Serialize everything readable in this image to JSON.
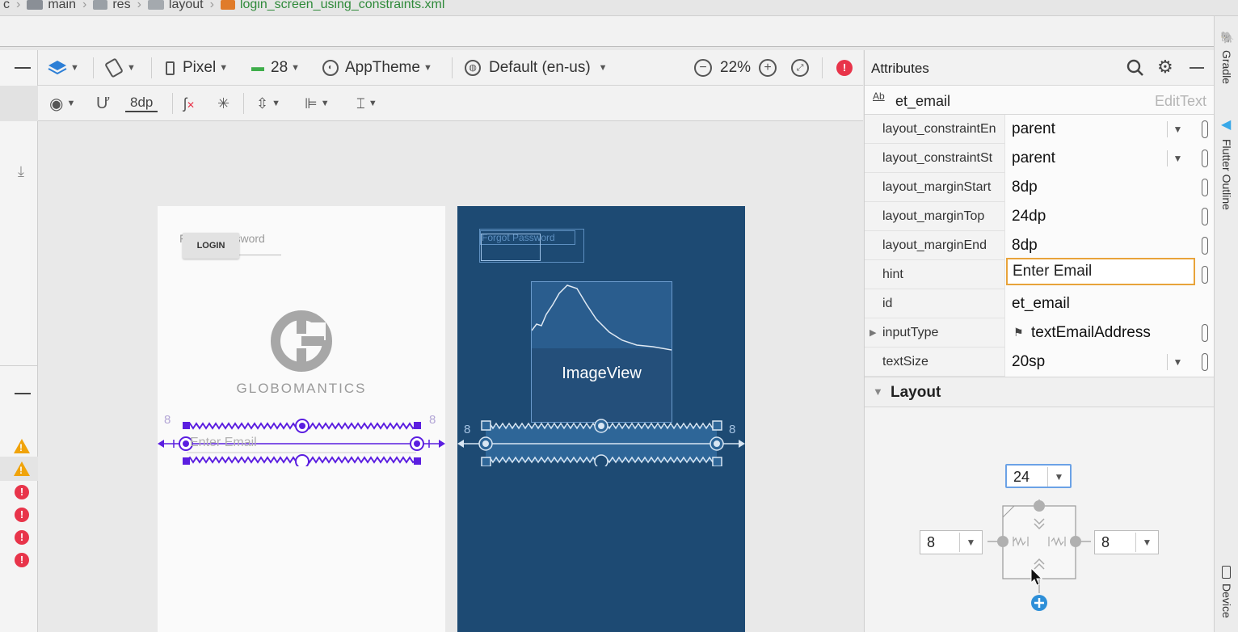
{
  "breadcrumb": {
    "leading": "c",
    "items": [
      {
        "label": "main",
        "icon": "folder-icon"
      },
      {
        "label": "res",
        "icon": "resource-folder-icon"
      },
      {
        "label": "layout",
        "icon": "layout-folder-icon"
      },
      {
        "label": "login_screen_using_constraints.xml",
        "icon": "xml-file-icon"
      }
    ]
  },
  "toolbar": {
    "device": "Pixel",
    "api_level": "28",
    "theme": "AppTheme",
    "locale": "Default (en-us)",
    "zoom": "22%",
    "default_margin": "8dp"
  },
  "design": {
    "forgot_password": "Forgot Password",
    "login_button": "LOGIN",
    "logo_text": "GLOBOMANTICS",
    "email_hint": "Enter Email",
    "margin_left": "8",
    "margin_right": "8",
    "imageview_label": "ImageView"
  },
  "attributes": {
    "title": "Attributes",
    "component_id": "et_email",
    "component_type": "EditText",
    "rows": [
      {
        "name": "layout_constraintEn",
        "value": "parent",
        "dropdown": true
      },
      {
        "name": "layout_constraintSt",
        "value": "parent",
        "dropdown": true
      },
      {
        "name": "layout_marginStart",
        "value": "8dp",
        "dropdown": false
      },
      {
        "name": "layout_marginTop",
        "value": "24dp",
        "dropdown": false
      },
      {
        "name": "layout_marginEnd",
        "value": "8dp",
        "dropdown": false
      },
      {
        "name": "hint",
        "value": "Enter Email",
        "dropdown": false
      },
      {
        "name": "id",
        "value": "et_email",
        "dropdown": false
      },
      {
        "name": "inputType",
        "value": "textEmailAddress",
        "dropdown": false
      },
      {
        "name": "textSize",
        "value": "20sp",
        "dropdown": true
      }
    ],
    "layout_section": "Layout",
    "constraint_widget": {
      "top": "24",
      "left": "8",
      "right": "8"
    }
  },
  "side_tools": {
    "gradle": "Gradle",
    "flutter_outline": "Flutter Outline",
    "device": "Device"
  },
  "colors": {
    "blueprint_bg": "#1d4a73",
    "selection": "#5b1ee0",
    "warning": "#f0a30a",
    "error": "#e8344a",
    "focus_border": "#e8a33a",
    "select_border": "#6ba2e6"
  }
}
